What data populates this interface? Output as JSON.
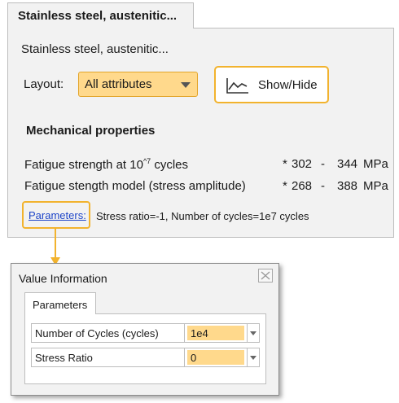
{
  "tab": {
    "title": "Stainless steel, austenitic..."
  },
  "panel": {
    "subtitle": "Stainless steel, austenitic...",
    "layout_label": "Layout:",
    "layout_select": {
      "value": "All attributes"
    },
    "show_hide_button": {
      "label": "Show/Hide",
      "icon": "line-chart-icon"
    },
    "section_title": "Mechanical properties",
    "properties": [
      {
        "name": "Fatigue strength at 10^7 cycles",
        "marker": "*",
        "low": "302",
        "dash": "-",
        "high": "344",
        "unit": "MPa"
      },
      {
        "name": "Fatigue stength model (stress amplitude)",
        "marker": "*",
        "low": "268",
        "dash": "-",
        "high": "388",
        "unit": "MPa"
      }
    ],
    "parameters_link": "Parameters:",
    "parameters_text": "Stress ratio=-1, Number of cycles=1e7 cycles"
  },
  "dialog": {
    "title": "Value Information",
    "tab": "Parameters",
    "rows": [
      {
        "name": "Number of Cycles (cycles)",
        "value": "1e4"
      },
      {
        "name": "Stress Ratio",
        "value": "0"
      }
    ]
  },
  "colors": {
    "highlight": "#f2b32e",
    "field_fill": "#ffd98c",
    "panel_bg": "#f2f2f2",
    "link": "#1d44c8"
  }
}
